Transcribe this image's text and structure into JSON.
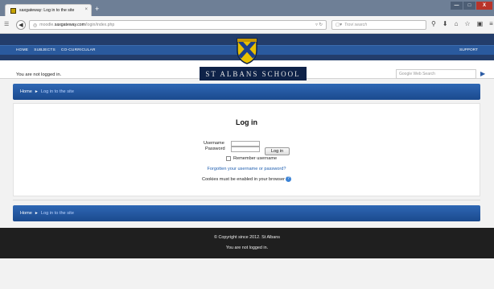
{
  "browser": {
    "tab_title": "saxgateway: Log in to the site",
    "new_tab": "+",
    "url_prefix": "moodle.",
    "url_domain": "saxgateway.com",
    "url_path": "/login/index.php",
    "search_placeholder": "Trovi search",
    "window_buttons": {
      "min": "—",
      "max": "□",
      "close": "X"
    }
  },
  "site": {
    "nav": [
      "HOME",
      "SUBJECTS",
      "CO-CURRICULAR"
    ],
    "support": "SUPPORT",
    "not_logged_in": "You are not logged in.",
    "school_name": "ST ALBANS SCHOOL",
    "google_search_placeholder": "Google Web Search"
  },
  "breadcrumb": {
    "home": "Home",
    "separator": "►",
    "current": "Log in to the site"
  },
  "login": {
    "title": "Log in",
    "username_label": "Username",
    "password_label": "Password",
    "button": "Log in",
    "remember": "Remember username",
    "forgot": "Forgotten your username or password?",
    "cookies": "Cookies must be enabled in your browser",
    "help_icon": "?"
  },
  "footer": {
    "copyright": "© Copyright since 2012. St Albans",
    "not_logged_in": "You are not logged in."
  },
  "colors": {
    "header_dark": "#233d6b",
    "breadcrumb_blue": "#2e67b4",
    "school_name_bg": "#0e2248",
    "footer_bg": "#1f1f1f",
    "link": "#1f5fb0"
  },
  "icons": [
    "favicon-icon",
    "back-arrow-icon",
    "globe-icon",
    "reload-icon",
    "search-icon",
    "download-icon",
    "home-icon",
    "star-icon",
    "bookmark-icon",
    "menu-icon",
    "crest-icon",
    "play-arrow-icon",
    "help-icon"
  ]
}
